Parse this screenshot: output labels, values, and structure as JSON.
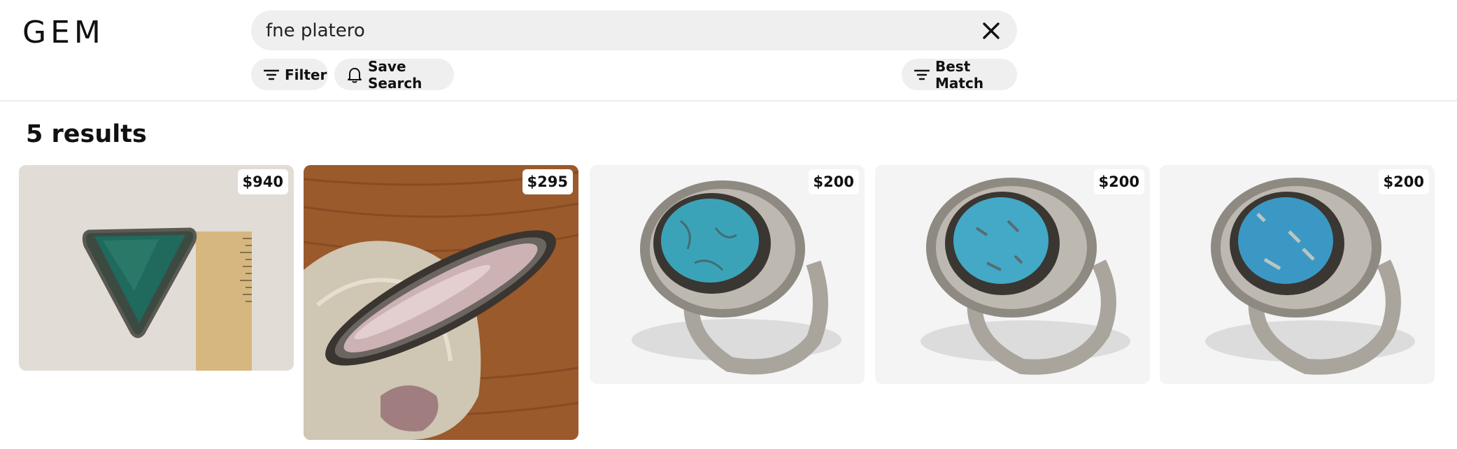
{
  "brand": {
    "logo_text": "GEM"
  },
  "search": {
    "query": "fne platero",
    "clear_icon": "close-icon"
  },
  "toolbar": {
    "filter_label": "Filter",
    "save_search_label": "Save Search",
    "sort_label": "Best Match"
  },
  "results": {
    "count_label": "5 results",
    "items": [
      {
        "price": "$940",
        "image": "triangular green stone pendant beside a ruler"
      },
      {
        "price": "$295",
        "image": "long oval mother-of-pearl brooch on a rock"
      },
      {
        "price": "$200",
        "image": "silver ring with oval turquoise stone"
      },
      {
        "price": "$200",
        "image": "silver ring with oval turquoise stone"
      },
      {
        "price": "$200",
        "image": "silver ring with oval turquoise stone"
      }
    ]
  },
  "colors": {
    "chip_bg": "#efefef",
    "search_bg": "#efefef",
    "turquoise": "#3ba3b8",
    "silver": "#a9a59c"
  }
}
